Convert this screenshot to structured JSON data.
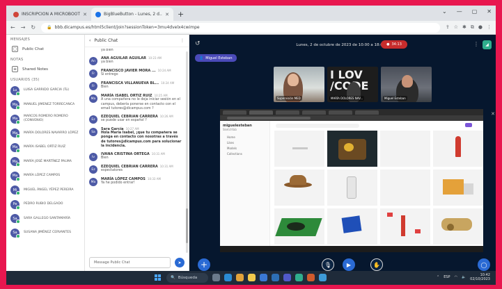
{
  "browser": {
    "tabs": [
      {
        "label": "INSCRIPCIÓN A MICROBOOTC",
        "active": false
      },
      {
        "label": "BigBlueButton - Lunes, 2 d...",
        "active": true
      }
    ],
    "new_tab": "+",
    "window_controls": [
      "⌄",
      "—",
      "▢",
      "✕"
    ],
    "url": "bbb.dicampus.es/html5client/join?sessionToken=3mu4dvelx4cwimpe"
  },
  "users_panel": {
    "messages_section": "MENSAJES",
    "public_chat": "Public Chat",
    "notes_section": "NOTAS",
    "shared_notes": "Shared Notes",
    "users_section": "USUARIOS (35)",
    "users": [
      {
        "initials": "Lu",
        "name": "LUISA GARRIDO GARCIA (Tú)"
      },
      {
        "initials": "Ma",
        "name": "MANUEL JIMENEZ TORRECANCA"
      },
      {
        "initials": "Ma",
        "name": "MARCOS ROMERO ROMERO (CONVENIO)"
      },
      {
        "initials": "Ma",
        "name": "MARÍA DOLORES NAVARRO LÓPEZ"
      },
      {
        "initials": "Ma",
        "name": "MARÍA ISABEL ORTIZ RUIZ"
      },
      {
        "initials": "Ma",
        "name": "MARÍA JOSÉ MARTÍNEZ PALMA"
      },
      {
        "initials": "Ma",
        "name": "MARÍA LÓPEZ CAMPOS"
      },
      {
        "initials": "Mi",
        "name": "MIGUEL ÁNGEL YÉPEZ PEREIRA"
      },
      {
        "initials": "Pe",
        "name": "PEDRO RUBIO DELGADO"
      },
      {
        "initials": "Sa",
        "name": "SARA GALLEGO SANTAMARÍA"
      },
      {
        "initials": "Sa",
        "name": "SUSANA JIMÉNEZ CERVANTES"
      }
    ]
  },
  "chat": {
    "title": "Public Chat",
    "back": "‹",
    "menu": "⋮",
    "messages": [
      {
        "initials": "",
        "name": "",
        "time": "",
        "text": "ya bien",
        "bold": false
      },
      {
        "initials": "An",
        "name": "ANA AGUILAR AGUILAR",
        "time": "10:23 AM",
        "text": "ya bien",
        "bold": false
      },
      {
        "initials": "Fr",
        "name": "FRANCISCO JAVIER MORA ...",
        "time": "10:24 AM",
        "text": "Si entrego",
        "bold": false
      },
      {
        "initials": "Fr",
        "name": "FRANCISCA VILLANUEVA BL...",
        "time": "10:24 AM",
        "text": "Bien",
        "bold": false
      },
      {
        "initials": "Ma",
        "name": "MARÍA ISABEL ORTIZ RUIZ",
        "time": "10:25 AM",
        "text": "A una compañera no le deja iniciar sesión en el campus, debería ponerse en contacto con el email tutores@dicampus.com ?",
        "bold": false
      },
      {
        "initials": "Ez",
        "name": "EZEQUIEL CEBRIAN CARRERA",
        "time": "10:26 AM",
        "text": "se puede usar en español ?",
        "bold": false
      },
      {
        "initials": "Sa",
        "name": "Sara García",
        "time": "10:27 AM",
        "text": "Hola María Isabel, ¡que tu compañera se ponga en contacto con nosotras a través de tutores@dicampus.com para solucionar la incidencia.",
        "bold": true
      },
      {
        "initials": "Iv",
        "name": "IVANA CRISTINA ORTEGA",
        "time": "10:31 AM",
        "text": "Bien",
        "bold": false
      },
      {
        "initials": "Ez",
        "name": "EZEQUIEL CEBRIAN CARRERA",
        "time": "10:31 AM",
        "text": "espectatores",
        "bold": false
      },
      {
        "initials": "Ma",
        "name": "MARÍA LÓPEZ CAMPOS",
        "time": "10:33 AM",
        "text": "Ya he podido entrar!",
        "bold": false
      }
    ],
    "input_placeholder": "Message Public Chat",
    "send": "➤"
  },
  "stage": {
    "meeting_title": "Lunes, 2 de octubre de 2023 de 10:00 a 18:00h.",
    "recording_time": "34:13",
    "presenter": "Miguel Esteban",
    "cams": [
      {
        "name": "Supervisión MED"
      },
      {
        "name": "MARÍA DOLORES NAV..."
      },
      {
        "name": "Miguel Esteban"
      }
    ],
    "cam_logo": "I LOV /CODE",
    "shared": {
      "title": "miguelesteban",
      "subtitle": "Sketchfab",
      "menu": [
        "Home",
        "Likes",
        "Models",
        "Collections"
      ]
    }
  },
  "taskbar": {
    "search": "Búsqueda",
    "time": "10:42",
    "date": "02/10/2023",
    "lang": "ESP"
  }
}
